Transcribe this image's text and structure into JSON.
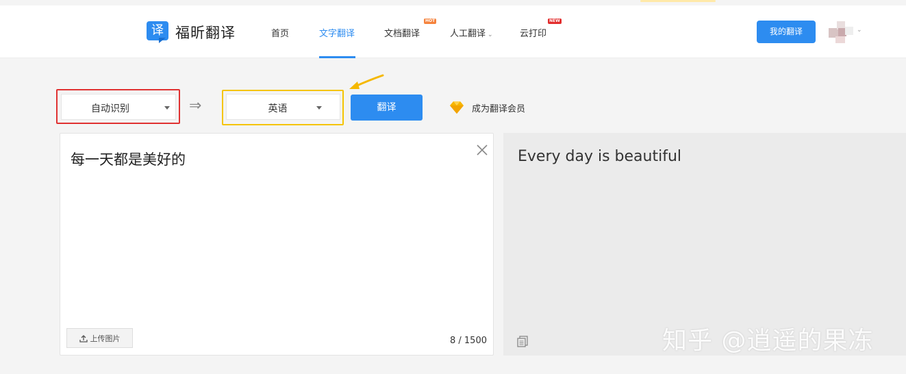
{
  "app": {
    "logo_glyph": "译",
    "logo_text": "福昕翻译",
    "accent_color": "#2d8cf0"
  },
  "nav": {
    "items": [
      {
        "label": "首页"
      },
      {
        "label": "文字翻译",
        "active": true
      },
      {
        "label": "文档翻译",
        "badge": "HOT"
      },
      {
        "label": "人工翻译",
        "has_dropdown": true
      },
      {
        "label": "云打印",
        "badge": "NEW"
      }
    ],
    "my_translations": "我的翻译"
  },
  "toolbar": {
    "source_language": "自动识别",
    "target_language": "英语",
    "swap_icon": "⇒",
    "translate_label": "翻译",
    "vip_label": "成为翻译会员"
  },
  "source_panel": {
    "text": "每一天都是美好的",
    "upload_label": "上传图片",
    "counter": "8 / 1500"
  },
  "target_panel": {
    "text": "Every day is beautiful"
  },
  "watermark": "知乎 @逍遥的果冻"
}
